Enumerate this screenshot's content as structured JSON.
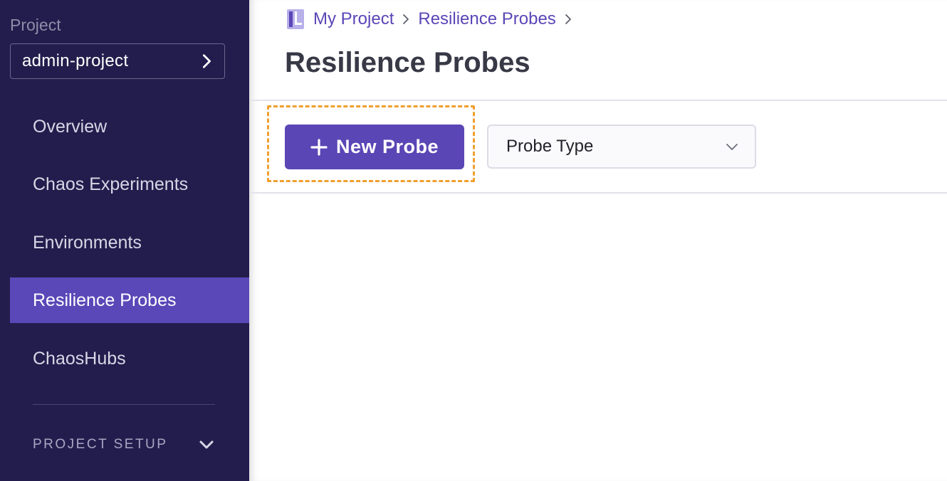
{
  "sidebar": {
    "section_label": "Project",
    "project_selector": {
      "value": "admin-project"
    },
    "items": [
      {
        "label": "Overview",
        "active": false
      },
      {
        "label": "Chaos Experiments",
        "active": false
      },
      {
        "label": "Environments",
        "active": false
      },
      {
        "label": "Resilience Probes",
        "active": true
      },
      {
        "label": "ChaosHubs",
        "active": false
      }
    ],
    "setup": {
      "label": "PROJECT SETUP",
      "icon": "chevron-down-icon"
    }
  },
  "breadcrumb": {
    "icon": "project-icon",
    "items": [
      {
        "label": "My Project"
      },
      {
        "label": "Resilience Probes"
      }
    ]
  },
  "page": {
    "title": "Resilience Probes"
  },
  "toolbar": {
    "new_probe_label": "New Probe",
    "new_probe_icon": "plus-icon",
    "probe_type_label": "Probe Type",
    "probe_type_icon": "chevron-down-icon"
  },
  "colors": {
    "sidebar_bg": "#231d4d",
    "accent": "#5b46b6",
    "highlight": "#ef9f2f"
  }
}
